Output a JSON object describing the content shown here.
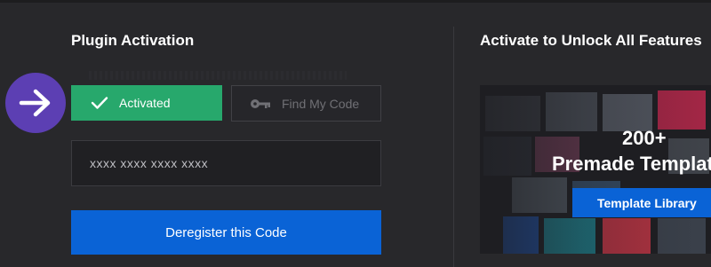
{
  "activation": {
    "title": "Plugin Activation",
    "status_label": "Activated",
    "find_code_label": "Find My Code",
    "code_value": "xxxx xxxx xxxx xxxx",
    "deregister_label": "Deregister this Code"
  },
  "promo": {
    "title": "Activate to Unlock All Features",
    "count": "200+",
    "headline": "Premade Templates",
    "library_label": "Template Library"
  },
  "colors": {
    "background": "#28282b",
    "success": "#27a86c",
    "primary": "#0a63d6",
    "accent_badge": "#5c3fb3"
  },
  "icons": {
    "arrow": "arrow-right-icon",
    "check": "check-icon",
    "key": "key-icon"
  }
}
